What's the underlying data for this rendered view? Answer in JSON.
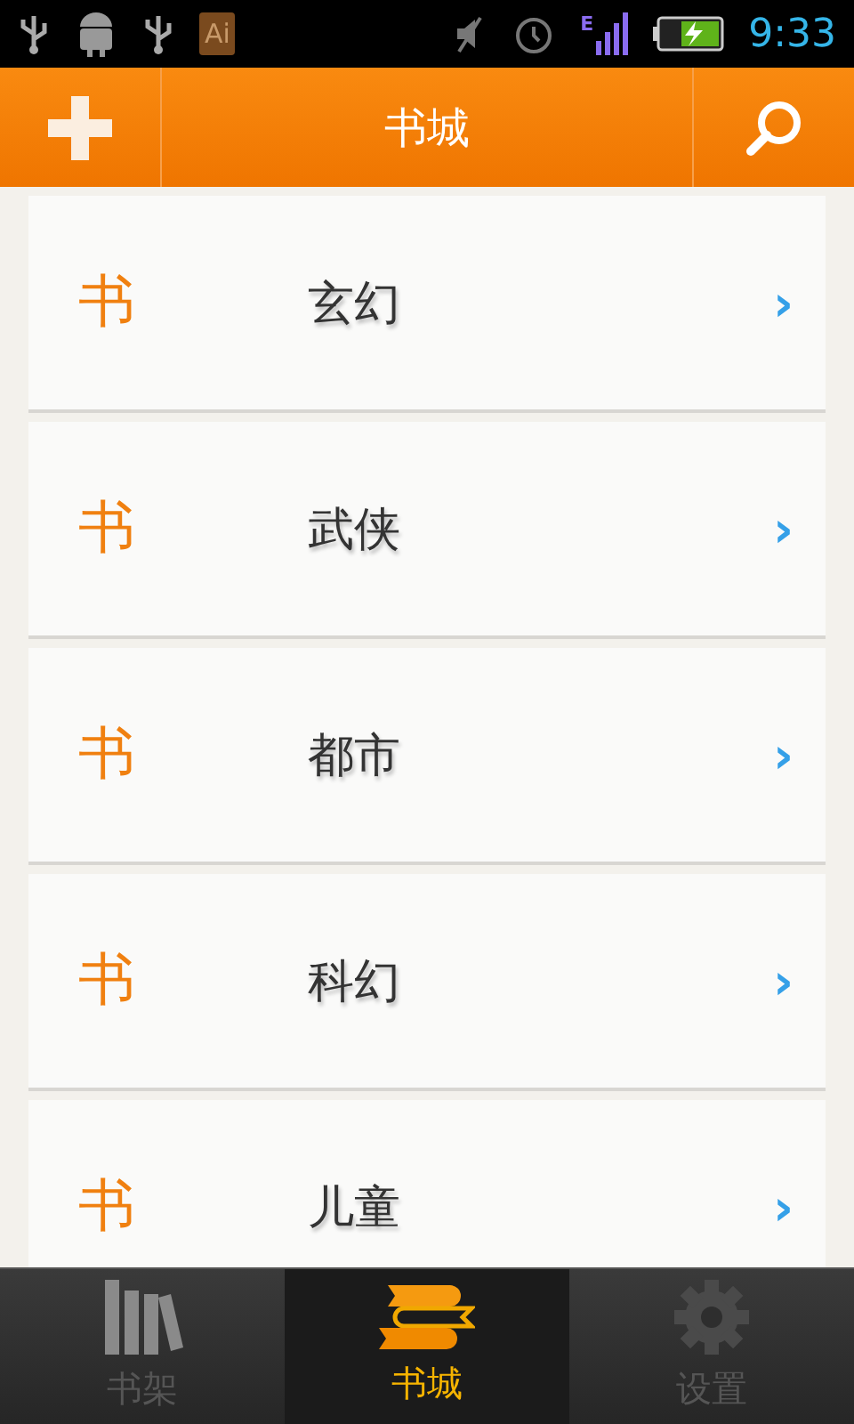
{
  "status_bar": {
    "app_badge": "Ai",
    "network_type": "E",
    "time": "9:33"
  },
  "header": {
    "title": "书城"
  },
  "categories": [
    {
      "icon_text": "书",
      "label": "玄幻",
      "chevron": "›"
    },
    {
      "icon_text": "书",
      "label": "武侠",
      "chevron": "›"
    },
    {
      "icon_text": "书",
      "label": "都市",
      "chevron": "›"
    },
    {
      "icon_text": "书",
      "label": "科幻",
      "chevron": "›"
    },
    {
      "icon_text": "书",
      "label": "儿童",
      "chevron": "›"
    }
  ],
  "tabs": [
    {
      "kind": "shelf",
      "label": "书架",
      "selected": false
    },
    {
      "kind": "store",
      "label": "书城",
      "selected": true
    },
    {
      "kind": "settings",
      "label": "设置",
      "selected": false
    }
  ]
}
